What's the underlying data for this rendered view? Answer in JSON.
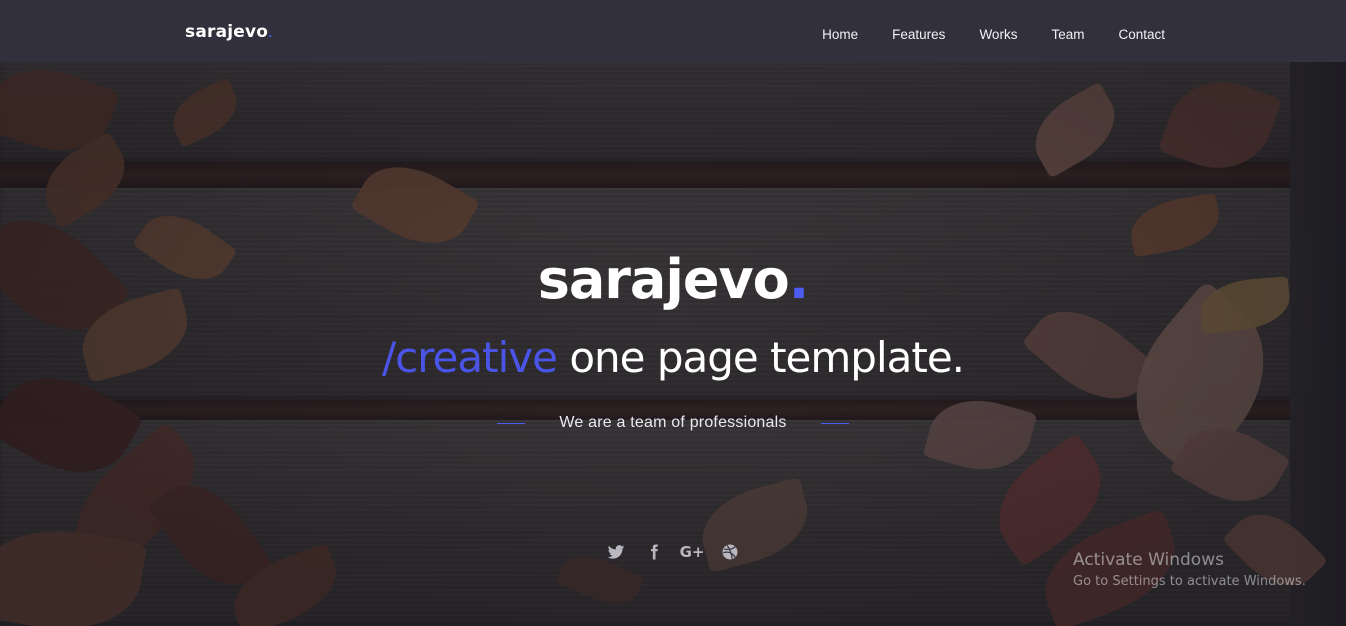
{
  "navbar": {
    "brand": "sarajevo",
    "brand_dot": ".",
    "links": [
      {
        "label": "Home"
      },
      {
        "label": "Features"
      },
      {
        "label": "Works"
      },
      {
        "label": "Team"
      },
      {
        "label": "Contact"
      }
    ]
  },
  "hero": {
    "title": "sarajevo",
    "title_dot": ".",
    "subtitle_accent": "/creative",
    "subtitle_rest": " one page template.",
    "tagline": "We are a team of professionals"
  },
  "social": [
    {
      "icon": "twitter-icon"
    },
    {
      "icon": "facebook-icon"
    },
    {
      "icon": "google-plus-icon",
      "text": "G+"
    },
    {
      "icon": "dribbble-icon"
    }
  ],
  "watermark": {
    "title": "Activate Windows",
    "subtitle": "Go to Settings to activate Windows."
  },
  "colors": {
    "accent": "#4d5bf0",
    "navbar_bg": "#3a3a4a",
    "text": "#ffffff"
  }
}
